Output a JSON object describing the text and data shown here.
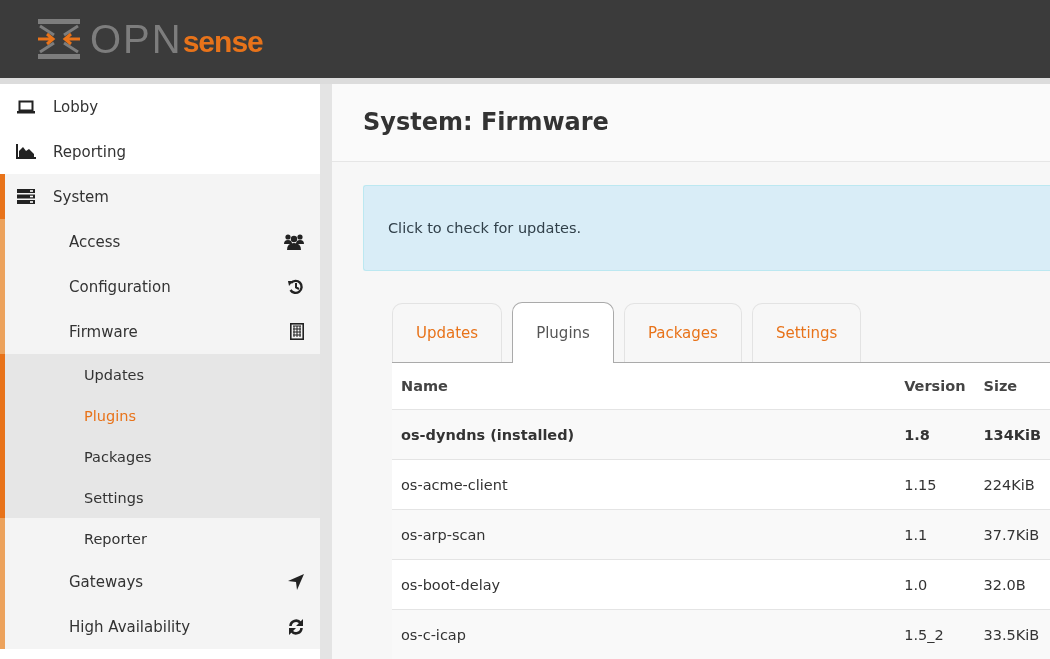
{
  "brand": {
    "left": "OPN",
    "right": "sense"
  },
  "sidebar": {
    "items": [
      {
        "label": "Lobby",
        "expanded": false
      },
      {
        "label": "Reporting",
        "expanded": false
      },
      {
        "label": "System",
        "expanded": true,
        "children": [
          {
            "label": "Access",
            "expanded": false
          },
          {
            "label": "Configuration",
            "expanded": false
          },
          {
            "label": "Firmware",
            "expanded": true,
            "children": [
              {
                "label": "Updates",
                "selected": false,
                "highlighted": true
              },
              {
                "label": "Plugins",
                "selected": true,
                "highlighted": true
              },
              {
                "label": "Packages",
                "selected": false,
                "highlighted": true
              },
              {
                "label": "Settings",
                "selected": false,
                "highlighted": true
              },
              {
                "label": "Reporter",
                "selected": false,
                "highlighted": false
              }
            ]
          },
          {
            "label": "Gateways",
            "expanded": false
          },
          {
            "label": "High Availability",
            "expanded": false
          }
        ]
      }
    ]
  },
  "page_title": "System: Firmware",
  "alert": "Click to check for updates.",
  "tabs": [
    {
      "label": "Updates",
      "selected": false
    },
    {
      "label": "Plugins",
      "selected": true
    },
    {
      "label": "Packages",
      "selected": false
    },
    {
      "label": "Settings",
      "selected": false
    }
  ],
  "table": {
    "columns": [
      "Name",
      "Version",
      "Size"
    ],
    "rows": [
      {
        "cells": [
          "os-dyndns (installed)",
          "1.8",
          "134KiB"
        ],
        "installed": true
      },
      {
        "cells": [
          "os-acme-client",
          "1.15",
          "224KiB"
        ],
        "installed": false
      },
      {
        "cells": [
          "os-arp-scan",
          "1.1",
          "37.7KiB"
        ],
        "installed": false
      },
      {
        "cells": [
          "os-boot-delay",
          "1.0",
          "32.0B"
        ],
        "installed": false
      },
      {
        "cells": [
          "os-c-icap",
          "1.5_2",
          "33.5KiB"
        ],
        "installed": false
      }
    ]
  }
}
